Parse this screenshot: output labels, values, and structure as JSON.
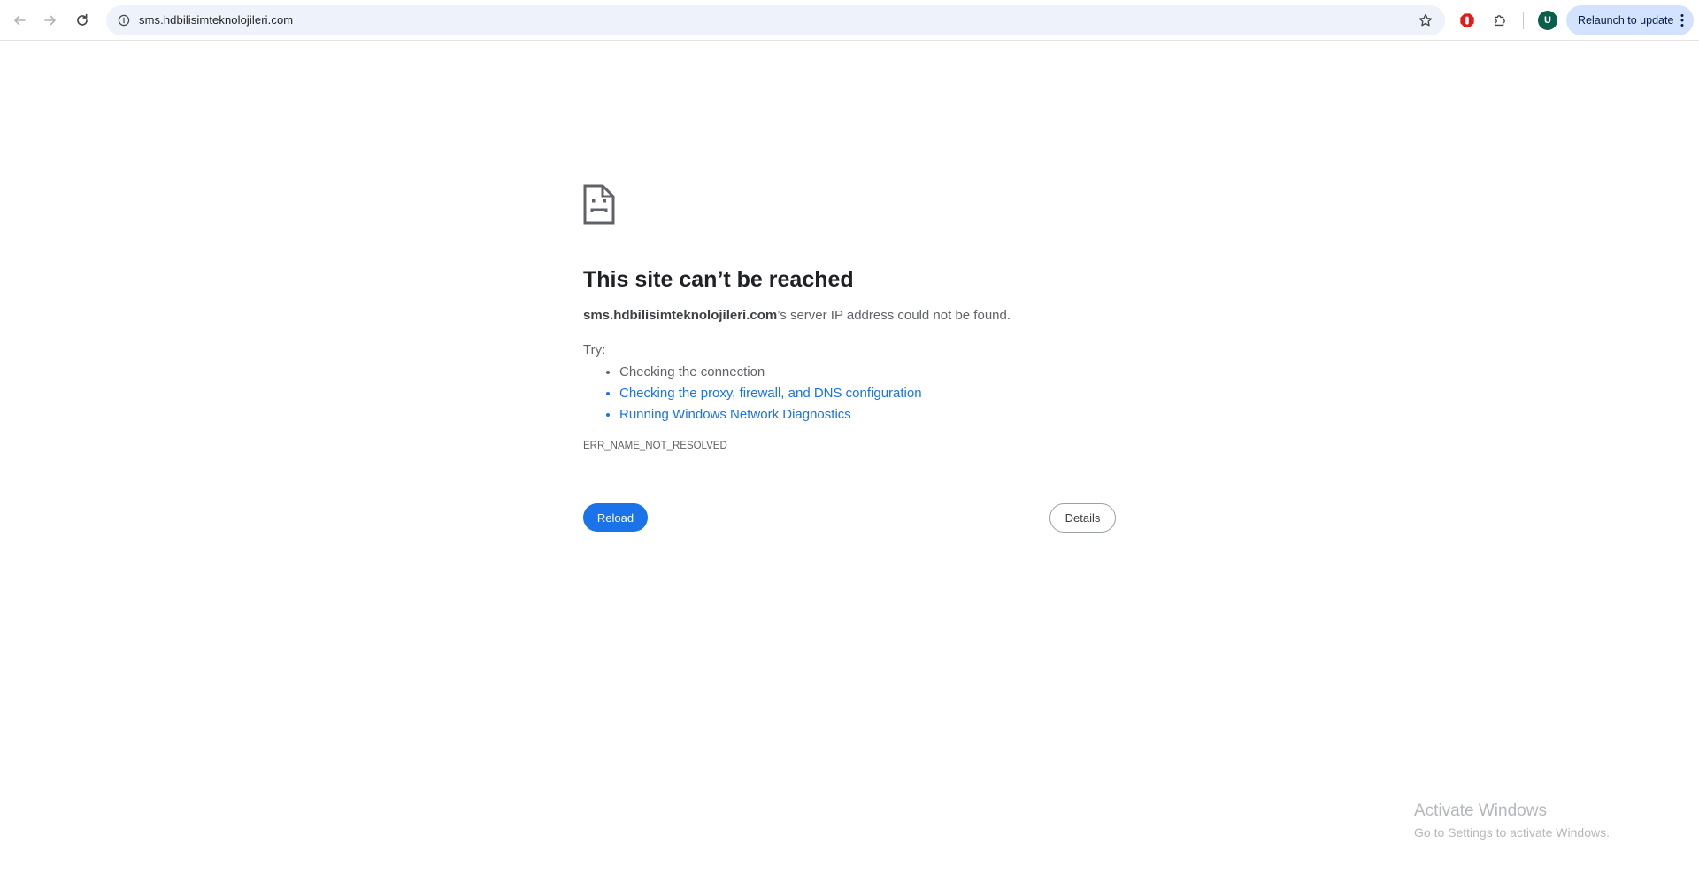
{
  "browser": {
    "url": "sms.hdbilisimteknolojileri.com",
    "profile_initial": "U",
    "relaunch_label": "Relaunch to update",
    "icons": {
      "back": "arrow-left-icon",
      "forward": "arrow-right-icon",
      "reload": "reload-icon",
      "site_info": "info-icon",
      "bookmark": "star-icon",
      "extension_adblock": "stop-sign-icon",
      "extensions": "puzzle-icon",
      "menu": "kebab-menu-icon"
    },
    "colors": {
      "omnibox_bg": "#eef2fa",
      "relaunch_bg": "#d3e3fd",
      "avatar_bg": "#0b5e4a"
    }
  },
  "error_page": {
    "icon": "sad-page-icon",
    "title": "This site can’t be reached",
    "host": "sms.hdbilisimteknolojileri.com",
    "description_suffix": "’s server IP address could not be found.",
    "try_label": "Try:",
    "suggestions": [
      "Checking the connection",
      "Checking the proxy, firewall, and DNS configuration",
      "Running Windows Network Diagnostics"
    ],
    "error_code": "ERR_NAME_NOT_RESOLVED",
    "reload_label": "Reload",
    "details_label": "Details",
    "colors": {
      "link": "#1a73e8",
      "reload_button": "#1a73e8"
    }
  },
  "watermark": {
    "title": "Activate Windows",
    "subtitle": "Go to Settings to activate Windows."
  }
}
